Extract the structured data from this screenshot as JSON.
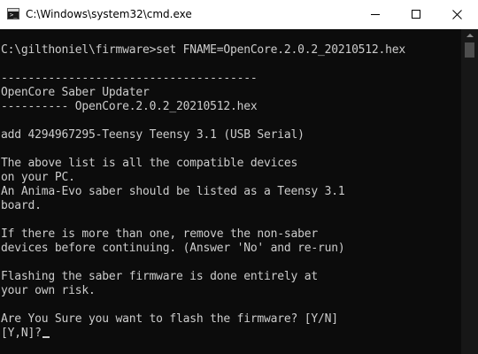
{
  "window": {
    "title": "C:\\Windows\\system32\\cmd.exe",
    "icon": "cmd-icon",
    "controls": {
      "minimize_icon": "minimize-icon",
      "maximize_icon": "maximize-icon",
      "close_icon": "close-icon"
    }
  },
  "console": {
    "foreground_color": "#cccccc",
    "background_color": "#0c0c0c",
    "lines": [
      "C:\\gilthoniel\\firmware>set FNAME=OpenCore.2.0.2_20210512.hex",
      "",
      "--------------------------------------",
      "OpenCore Saber Updater",
      "---------- OpenCore.2.0.2_20210512.hex",
      "",
      "add 4294967295-Teensy Teensy 3.1 (USB Serial)",
      "",
      "The above list is all the compatible devices",
      "on your PC.",
      "An Anima-Evo saber should be listed as a Teensy 3.1",
      "board.",
      "",
      "If there is more than one, remove the non-saber",
      "devices before continuing. (Answer 'No' and re-run)",
      "",
      "Flashing the saber firmware is done entirely at",
      "your own risk.",
      "",
      "Are You Sure you want to flash the firmware? [Y/N]",
      "[Y,N]?"
    ]
  }
}
